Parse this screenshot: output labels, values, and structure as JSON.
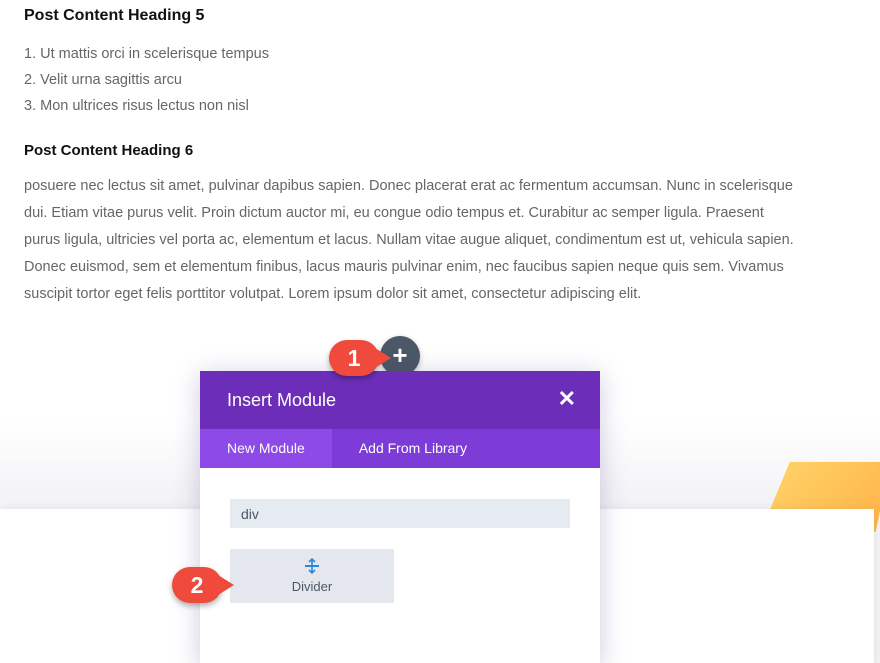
{
  "post": {
    "heading5": "Post Content Heading 5",
    "list": [
      "1. Ut mattis orci in scelerisque tempus",
      "2. Velit urna sagittis arcu",
      "3. Mon ultrices risus lectus non nisl"
    ],
    "heading6": "Post Content Heading 6",
    "paragraph": "posuere nec lectus sit amet, pulvinar dapibus sapien. Donec placerat erat ac fermentum accumsan. Nunc in scelerisque dui. Etiam vitae purus velit. Proin dictum auctor mi, eu congue odio tempus et. Curabitur ac semper ligula. Praesent purus ligula, ultricies vel porta ac, elementum et lacus. Nullam vitae augue aliquet, condimentum est ut, vehicula sapien. Donec euismod, sem et elementum finibus, lacus mauris pulvinar enim, nec faucibus sapien neque quis sem. Vivamus suscipit tortor eget felis porttitor volutpat. Lorem ipsum dolor sit amet, consectetur adipiscing elit."
  },
  "add_button": {
    "icon": "plus-icon",
    "label": "+"
  },
  "modal": {
    "title": "Insert Module",
    "close_label": "✕",
    "tabs": [
      {
        "label": "New Module",
        "active": true
      },
      {
        "label": "Add From Library",
        "active": false
      }
    ],
    "search_value": "div",
    "modules": [
      {
        "label": "Divider",
        "icon": "divider-icon"
      }
    ]
  },
  "annotations": [
    {
      "label": "1"
    },
    {
      "label": "2"
    }
  ],
  "colors": {
    "modal_header": "#6c2eb9",
    "tabs_bar": "#7d3bd8",
    "active_tab": "#8e4ae6",
    "badge": "#ef4a3c",
    "add_button": "#4c5866",
    "accent_orange": "#ffc15a"
  }
}
